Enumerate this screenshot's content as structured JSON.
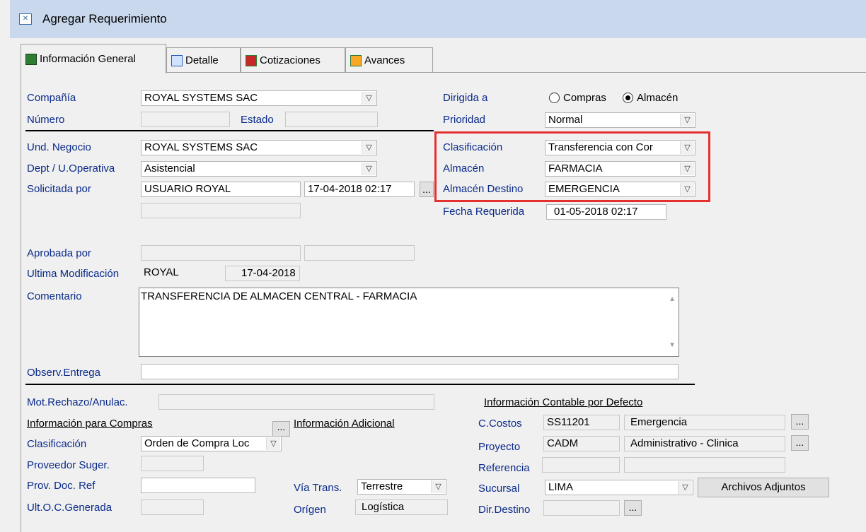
{
  "window": {
    "title": "Agregar Requerimiento"
  },
  "tabs": [
    {
      "label": "Información General"
    },
    {
      "label": "Detalle"
    },
    {
      "label": "Cotizaciones"
    },
    {
      "label": "Avances"
    }
  ],
  "form": {
    "compania_label": "Compañía",
    "compania_value": "ROYAL SYSTEMS SAC",
    "numero_label": "Número",
    "estado_label": "Estado",
    "dirigida_label": "Dirigida a",
    "dirigida_opt1": "Compras",
    "dirigida_opt2": "Almacén",
    "prioridad_label": "Prioridad",
    "prioridad_value": "Normal",
    "und_negocio_label": "Und. Negocio",
    "und_negocio_value": "ROYAL SYSTEMS SAC",
    "dept_label": "Dept / U.Operativa",
    "dept_value": "Asistencial",
    "solicitada_label": "Solicitada por",
    "solicitada_value": "USUARIO ROYAL",
    "solicitada_fecha": "17-04-2018  02:17",
    "clasificacion_label": "Clasificación",
    "clasificacion_value": "Transferencia con Cor",
    "almacen_label": "Almacén",
    "almacen_value": "FARMACIA",
    "almacen_destino_label": "Almacén Destino",
    "almacen_destino_value": "EMERGENCIA",
    "fecha_requerida_label": "Fecha Requerida",
    "fecha_requerida_value": "01-05-2018 02:17",
    "aprobada_label": "Aprobada por",
    "ultima_mod_label": "Ultima Modificación",
    "ultima_mod_user": "ROYAL",
    "ultima_mod_fecha": "17-04-2018",
    "comentario_label": "Comentario",
    "comentario_value": "TRANSFERENCIA DE ALMACEN CENTRAL - FARMACIA",
    "observ_label": "Observ.Entrega",
    "ellipsis": "..."
  },
  "lower": {
    "mot_rechazo_label": "Mot.Rechazo/Anulac.",
    "info_compras_label": "Información para Compras",
    "info_adicional_label": "Información Adicional",
    "info_contable_label": "Información Contable por Defecto",
    "clasif_label": "Clasificación",
    "clasif_value": "Orden de Compra Loc",
    "proveedor_label": "Proveedor Suger.",
    "prov_doc_label": "Prov. Doc. Ref",
    "ult_oc_label": "Ult.O.C.Generada",
    "via_trans_label": "Vía Trans.",
    "via_trans_value": "Terrestre",
    "origen_label": "Orígen",
    "origen_value": "Logística",
    "ccostos_label": "C.Costos",
    "ccostos_code": "SS11201",
    "ccostos_name": "Emergencia",
    "proyecto_label": "Proyecto",
    "proyecto_code": "CADM",
    "proyecto_name": "Administrativo - Clinica",
    "referencia_label": "Referencia",
    "sucursal_label": "Sucursal",
    "sucursal_value": "LIMA",
    "archivos_button": "Archivos Adjuntos",
    "dir_destino_label": "Dir.Destino"
  },
  "colors": {
    "label_blue": "#0a2a8a",
    "highlight": "#e53030",
    "titlebar": "#c9d8ec"
  }
}
